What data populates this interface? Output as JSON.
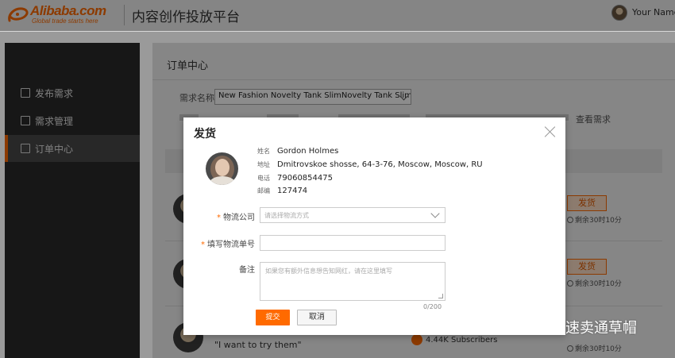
{
  "header": {
    "logo_word": "Alibaba.com",
    "logo_slogan": "Global trade starts here",
    "platform_title": "内容创作投放平台",
    "user_name": "Your Name"
  },
  "sidebar": {
    "items": [
      {
        "label": "发布需求",
        "active": false
      },
      {
        "label": "需求管理",
        "active": false
      },
      {
        "label": "订单中心",
        "active": true
      }
    ]
  },
  "main": {
    "title": "订单中心",
    "filter": {
      "label": "需求名称:",
      "selected": "New Fashion Novelty Tank SlimNovelty Tank Slim ..."
    },
    "view_requirement": "查看需求",
    "rows": [
      {
        "ship_label": "发货",
        "remaining": "剩余30时10分"
      },
      {
        "ship_label": "发货",
        "remaining": "剩余30时10分"
      },
      {
        "ship_label": "",
        "remaining": "剩余30时10分"
      }
    ],
    "quote": "\"I want to try them\"",
    "subscribers": "4.44K Subscribers"
  },
  "modal": {
    "title": "发货",
    "recipient": [
      {
        "key": "姓名",
        "value": "Gordon Holmes"
      },
      {
        "key": "地址",
        "value": "Dmitrovskoe shosse, 64-3-76, Moscow, Moscow, RU"
      },
      {
        "key": "电话",
        "value": "79060854475"
      },
      {
        "key": "邮编",
        "value": "127474"
      }
    ],
    "logistics": {
      "label": "物流公司",
      "placeholder": "请选择物流方式"
    },
    "tracking": {
      "label": "填写物流单号",
      "value": ""
    },
    "remark": {
      "label": "备注",
      "placeholder": "如果您有额外信息想告知网红，请在这里填写"
    },
    "char_count": "0/200",
    "submit_label": "提交",
    "cancel_label": "取消"
  },
  "watermark": {
    "text": "速卖通草帽"
  },
  "colors": {
    "accent": "#ff6a00",
    "sidebar": "#2a2a2a",
    "overlay": "rgba(0,0,0,0.45)"
  }
}
